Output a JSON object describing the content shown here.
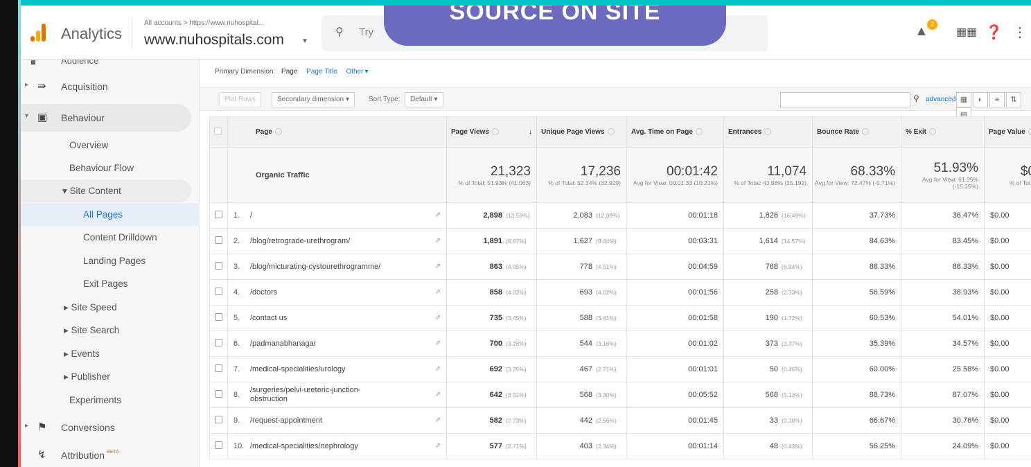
{
  "banner": "SOURCE ON SITE",
  "header": {
    "app_name": "Analytics",
    "account_crumb": "All accounts > https://www.nuhospital...",
    "account_name": "www.nuhospitals.com",
    "search_placeholder": "Try"
  },
  "notifications_count": "2",
  "sidebar": {
    "top_item": "Audience",
    "acquisition": "Acquisition",
    "behaviour": "Behaviour",
    "overview": "Overview",
    "behaviour_flow": "Behaviour Flow",
    "site_content": "Site Content",
    "all_pages": "All Pages",
    "content_drilldown": "Content Drilldown",
    "landing_pages": "Landing Pages",
    "exit_pages": "Exit Pages",
    "site_speed": "Site Speed",
    "site_search": "Site Search",
    "events": "Events",
    "publisher": "Publisher",
    "experiments": "Experiments",
    "conversions": "Conversions",
    "attribution": "Attribution",
    "beta": "BETA"
  },
  "primary_dimension": {
    "label": "Primary Dimension:",
    "selected": "Page",
    "page_title": "Page Title",
    "other": "Other"
  },
  "toolbar": {
    "plot_rows": "Plot Rows",
    "secondary_dimension": "Secondary dimension",
    "sort_type_label": "Sort Type:",
    "sort_type_value": "Default",
    "advanced": "advanced"
  },
  "table": {
    "headers": {
      "page": "Page",
      "page_views": "Page Views",
      "unique_page_views": "Unique Page Views",
      "avg_time": "Avg. Time on Page",
      "entrances": "Entrances",
      "bounce_rate": "Bounce Rate",
      "exit": "% Exit",
      "page_value": "Page Value"
    },
    "totals": {
      "name": "Organic Traffic",
      "page_views": "21,323",
      "page_views_sub": "% of Total: 51.93% (41,063)",
      "unique_page_views": "17,236",
      "unique_page_views_sub": "% of Total: 52.34% (32,929)",
      "avg_time": "00:01:42",
      "avg_time_sub": "Avg for View: 00:01:33 (10.21%)",
      "entrances": "11,074",
      "entrances_sub": "% of Total: 43.96% (25,192)",
      "bounce_rate": "68.33%",
      "bounce_rate_sub": "Avg for View: 72.47% (-5.71%)",
      "exit": "51.93%",
      "exit_sub": "Avg for View: 61.35% (-15.35%)",
      "page_value": "$0",
      "page_value_sub": "% of Total"
    },
    "rows": [
      {
        "idx": "1.",
        "page": "/",
        "pv": "2,898",
        "pv_pct": "(13.59%)",
        "upv": "2,083",
        "upv_pct": "(12.09%)",
        "time": "00:01:18",
        "ent": "1,826",
        "ent_pct": "(16.49%)",
        "bounce": "37.73%",
        "exit": "36.47%",
        "value": "$0.00"
      },
      {
        "idx": "2.",
        "page": "/blog/retrograde-urethrogram/",
        "pv": "1,891",
        "pv_pct": "(8.87%)",
        "upv": "1,627",
        "upv_pct": "(9.44%)",
        "time": "00:03:31",
        "ent": "1,614",
        "ent_pct": "(14.57%)",
        "bounce": "84.63%",
        "exit": "83.45%",
        "value": "$0.00"
      },
      {
        "idx": "3.",
        "page": "/blog/micturating-cystourethrogramme/",
        "pv": "863",
        "pv_pct": "(4.05%)",
        "upv": "778",
        "upv_pct": "(4.51%)",
        "time": "00:04:59",
        "ent": "768",
        "ent_pct": "(6.94%)",
        "bounce": "86.33%",
        "exit": "86.33%",
        "value": "$0.00"
      },
      {
        "idx": "4.",
        "page": "/doctors",
        "pv": "858",
        "pv_pct": "(4.02%)",
        "upv": "693",
        "upv_pct": "(4.02%)",
        "time": "00:01:56",
        "ent": "258",
        "ent_pct": "(2.33%)",
        "bounce": "56.59%",
        "exit": "38.93%",
        "value": "$0.00"
      },
      {
        "idx": "5.",
        "page": "/contact us",
        "pv": "735",
        "pv_pct": "(3.45%)",
        "upv": "588",
        "upv_pct": "(3.41%)",
        "time": "00:01:58",
        "ent": "190",
        "ent_pct": "(1.72%)",
        "bounce": "60.53%",
        "exit": "54.01%",
        "value": "$0.00"
      },
      {
        "idx": "6.",
        "page": "/padmanabhanagar",
        "pv": "700",
        "pv_pct": "(3.28%)",
        "upv": "544",
        "upv_pct": "(3.16%)",
        "time": "00:01:02",
        "ent": "373",
        "ent_pct": "(3.37%)",
        "bounce": "35.39%",
        "exit": "34.57%",
        "value": "$0.00"
      },
      {
        "idx": "7.",
        "page": "/medical-specialities/urology",
        "pv": "692",
        "pv_pct": "(3.25%)",
        "upv": "467",
        "upv_pct": "(2.71%)",
        "time": "00:01:01",
        "ent": "50",
        "ent_pct": "(0.45%)",
        "bounce": "60.00%",
        "exit": "25.58%",
        "value": "$0.00"
      },
      {
        "idx": "8.",
        "page": "/surgeries/pelvi-ureteric-junction-obstruction",
        "pv": "642",
        "pv_pct": "(3.01%)",
        "upv": "568",
        "upv_pct": "(3.30%)",
        "time": "00:05:52",
        "ent": "568",
        "ent_pct": "(5.13%)",
        "bounce": "88.73%",
        "exit": "87.07%",
        "value": "$0.00"
      },
      {
        "idx": "9.",
        "page": "/request-appointment",
        "pv": "582",
        "pv_pct": "(2.73%)",
        "upv": "442",
        "upv_pct": "(2.56%)",
        "time": "00:01:45",
        "ent": "33",
        "ent_pct": "(0.30%)",
        "bounce": "66.67%",
        "exit": "30.76%",
        "value": "$0.00"
      },
      {
        "idx": "10.",
        "page": "/medical-specialities/nephrology",
        "pv": "577",
        "pv_pct": "(2.71%)",
        "upv": "403",
        "upv_pct": "(2.34%)",
        "time": "00:01:14",
        "ent": "48",
        "ent_pct": "(0.43%)",
        "bounce": "56.25%",
        "exit": "24.09%",
        "value": "$0.00"
      }
    ]
  }
}
